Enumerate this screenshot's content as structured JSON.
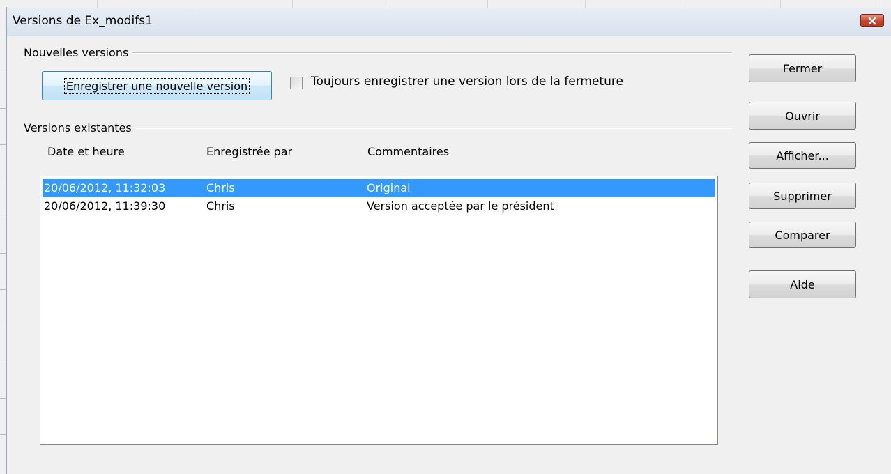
{
  "window": {
    "title": "Versions de Ex_modifs1"
  },
  "new_versions": {
    "group_label": "Nouvelles versions",
    "save_button_label": "Enregistrer une nouvelle version",
    "always_save_label": "Toujours enregistrer une version lors de la fermeture",
    "always_save_checked": false
  },
  "existing_versions": {
    "group_label": "Versions existantes",
    "columns": [
      "Date et heure",
      "Enregistrée par",
      "Commentaires"
    ],
    "rows": [
      {
        "date": "20/06/2012, 11:32:03",
        "by": "Chris",
        "comment": "Original",
        "selected": true
      },
      {
        "date": "20/06/2012, 11:39:30",
        "by": "Chris",
        "comment": "Version acceptée par le président",
        "selected": false
      }
    ]
  },
  "buttons": {
    "close": "Fermer",
    "open": "Ouvrir",
    "show": "Afficher...",
    "delete": "Supprimer",
    "compare": "Comparer",
    "help": "Aide"
  },
  "colors": {
    "selection": "#3399ff",
    "close_button": "#c7442a"
  },
  "icons": {
    "close": "close-icon"
  }
}
